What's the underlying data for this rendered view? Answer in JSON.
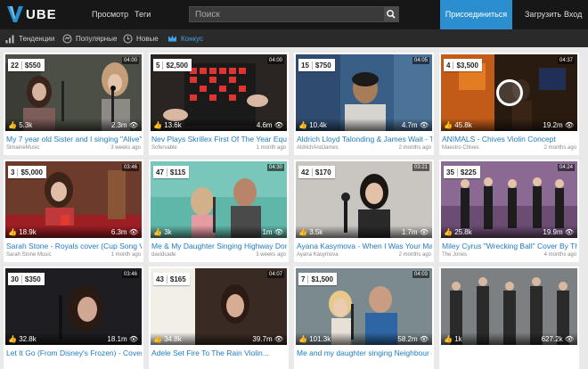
{
  "header": {
    "logo_text": "UBE",
    "nav": [
      "Просмотр",
      "Теги"
    ],
    "search_placeholder": "Поиск",
    "subscribe_label": "Присоединиться",
    "upload_label": "Загрузить",
    "login_label": "Вход"
  },
  "tabs": [
    {
      "label": "Тенденции",
      "icon": "trending-icon"
    },
    {
      "label": "Популярные",
      "icon": "popular-icon"
    },
    {
      "label": "Новые",
      "icon": "clock-icon"
    },
    {
      "label": "Конкус",
      "icon": "contest-icon",
      "active": true
    }
  ],
  "colors": {
    "topbar": "#171717",
    "subbar": "#2a2a2a",
    "accent": "#2a8ecf",
    "link": "#1d7cc2"
  },
  "videos": [
    {
      "rank": "22",
      "price": "$550",
      "duration": "04:00",
      "likes": "5.3k",
      "views": "2.3m",
      "title": "My 7 year old Sister and I singing \"Alive\" by K...",
      "author": "SimaineMusic",
      "ago": "3 weeks ago"
    },
    {
      "rank": "5",
      "price": "$2,500",
      "duration": "04:00",
      "likes": "13.6k",
      "views": "4.6m",
      "title": "Nev Plays Skrillex First Of The Year Equinox...",
      "author": "Sofervable",
      "ago": "1 month ago"
    },
    {
      "rank": "15",
      "price": "$750",
      "duration": "04:05",
      "likes": "10.4k",
      "views": "4.7m",
      "title": "Aldrich Lloyd Talonding & James Wait - Terif...",
      "author": "AldrichAndJames",
      "ago": "2 months ago"
    },
    {
      "rank": "4",
      "price": "$3,500",
      "duration": "04:37",
      "likes": "45.8k",
      "views": "19.2m",
      "title": "ANIMALS - Chives Violin Concept",
      "author": "Maestro Chives",
      "ago": "2 months ago"
    },
    {
      "rank": "3",
      "price": "$5,000",
      "duration": "03:46",
      "likes": "18.9k",
      "views": "6.3m",
      "title": "Sarah Stone - Royals cover (Cup Song Versi...",
      "author": "Sarah Stone Music",
      "ago": "1 month ago"
    },
    {
      "rank": "47",
      "price": "$115",
      "duration": "04:30",
      "likes": "3k",
      "views": "1m",
      "title": "Me & My Daughter Singing Highway Don't Ca...",
      "author": "davidcade",
      "ago": "3 weeks ago"
    },
    {
      "rank": "42",
      "price": "$170",
      "duration": "03:21",
      "likes": "3.5k",
      "views": "1.7m",
      "title": "Ayana Kasymova - When I Was Your Man",
      "author": "Ayana Kasymova",
      "ago": "2 months ago"
    },
    {
      "rank": "35",
      "price": "$225",
      "duration": "04:24",
      "likes": "25.8k",
      "views": "19.9m",
      "title": "Miley Cyrus \"Wrecking Ball\" Cover By The Ja...",
      "author": "The Jones",
      "ago": "4 months ago"
    },
    {
      "rank": "30",
      "price": "$350",
      "duration": "03:46",
      "likes": "32.8k",
      "views": "18.1m",
      "title": "Let It Go (From Disney's Frozen) - Cover th...",
      "author": "",
      "ago": ""
    },
    {
      "rank": "43",
      "price": "$165",
      "duration": "04:07",
      "likes": "34.8k",
      "views": "39.7m",
      "title": "Adele Set Fire To The Rain Violin...",
      "author": "",
      "ago": ""
    },
    {
      "rank": "7",
      "price": "$1,500",
      "duration": "04:03",
      "likes": "101.3k",
      "views": "58.2m",
      "title": "Me and my daughter singing Neighbour (Ha...",
      "author": "",
      "ago": ""
    },
    {
      "rank": "",
      "price": "",
      "duration": "",
      "likes": "1k",
      "views": "627.2k",
      "title": "",
      "author": "",
      "ago": ""
    }
  ]
}
